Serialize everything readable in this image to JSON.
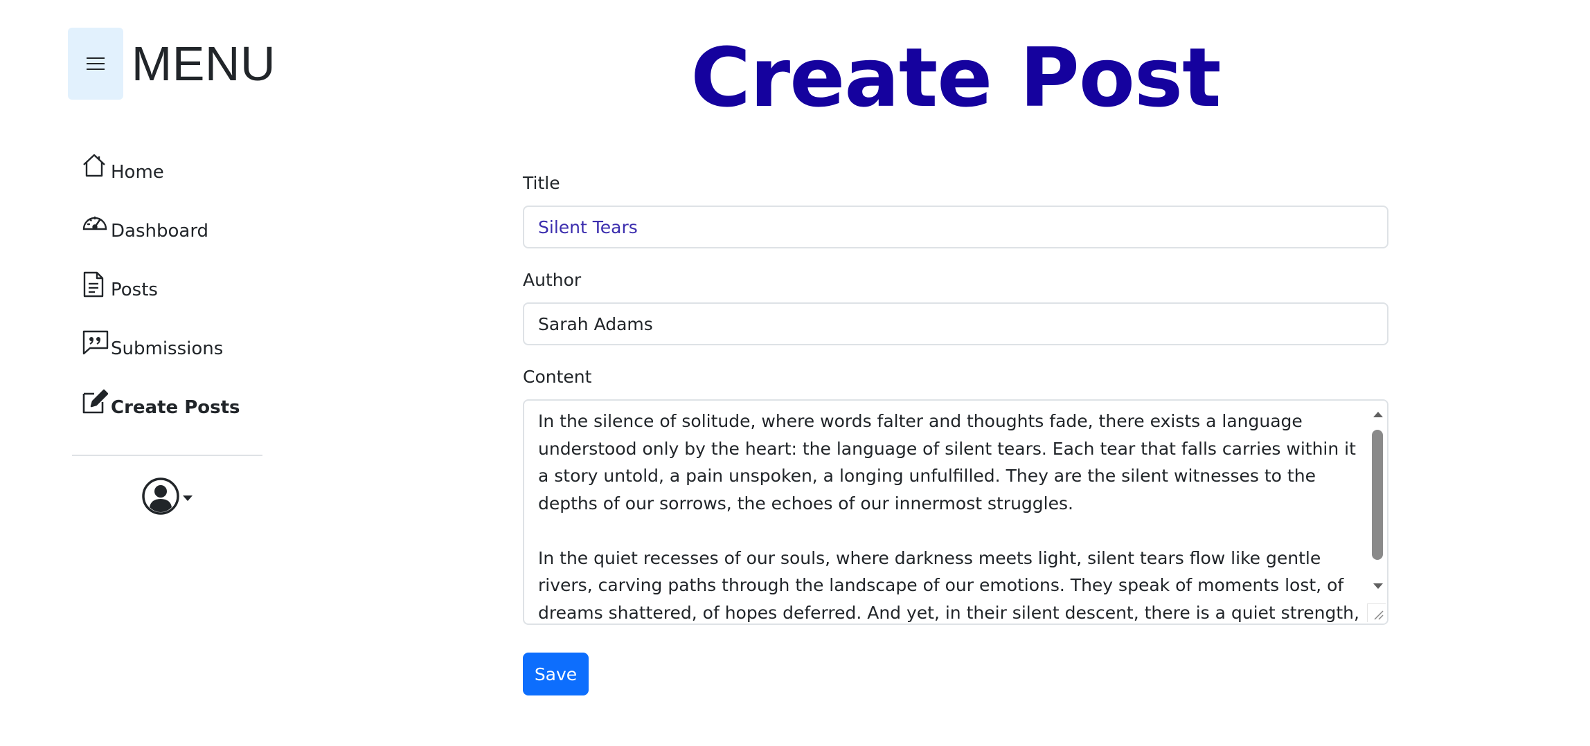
{
  "sidebar": {
    "menu_icon": "hamburger-icon",
    "menu_title": "MENU",
    "items": [
      {
        "label": "Home",
        "icon": "home-icon"
      },
      {
        "label": "Dashboard",
        "icon": "speedometer-icon"
      },
      {
        "label": "Posts",
        "icon": "document-icon"
      },
      {
        "label": "Submissions",
        "icon": "chat-quote-icon"
      },
      {
        "label": "Create Posts",
        "icon": "edit-icon",
        "active": true
      }
    ],
    "profile_icon": "user-circle-icon"
  },
  "main": {
    "title": "Create Post",
    "title_color": "#15029e",
    "form": {
      "title_label": "Title",
      "title_value": "Silent Tears",
      "author_label": "Author",
      "author_value": "Sarah Adams",
      "content_label": "Content",
      "content_value": "In the silence of solitude, where words falter and thoughts fade, there exists a language understood only by the heart: the language of silent tears. Each tear that falls carries within it a story untold, a pain unspoken, a longing unfulfilled. They are the silent witnesses to the depths of our sorrows, the echoes of our innermost struggles.\n\nIn the quiet recesses of our souls, where darkness meets light, silent tears flow like gentle rivers, carving paths through the landscape of our emotions. They speak of moments lost, of dreams shattered, of hopes deferred. And yet, in their silent descent, there is a quiet strength, a resilience born",
      "save_label": "Save"
    },
    "accent_color": "#0d6efd"
  }
}
